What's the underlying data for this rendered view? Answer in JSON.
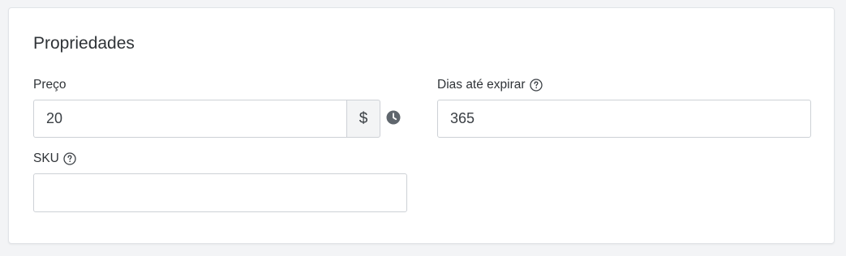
{
  "section": {
    "title": "Propriedades"
  },
  "price": {
    "label": "Preço",
    "value": "20",
    "currency_symbol": "$"
  },
  "expiry": {
    "label": "Dias até expirar",
    "value": "365"
  },
  "sku": {
    "label": "SKU",
    "value": ""
  },
  "icons": {
    "help": "help-circle-icon",
    "schedule": "clock-icon"
  },
  "colors": {
    "text": "#2f3337",
    "border": "#cdd1d6",
    "addon_background": "#f3f4f5",
    "page_background": "#f3f4f6",
    "icon": "#5f666d"
  }
}
